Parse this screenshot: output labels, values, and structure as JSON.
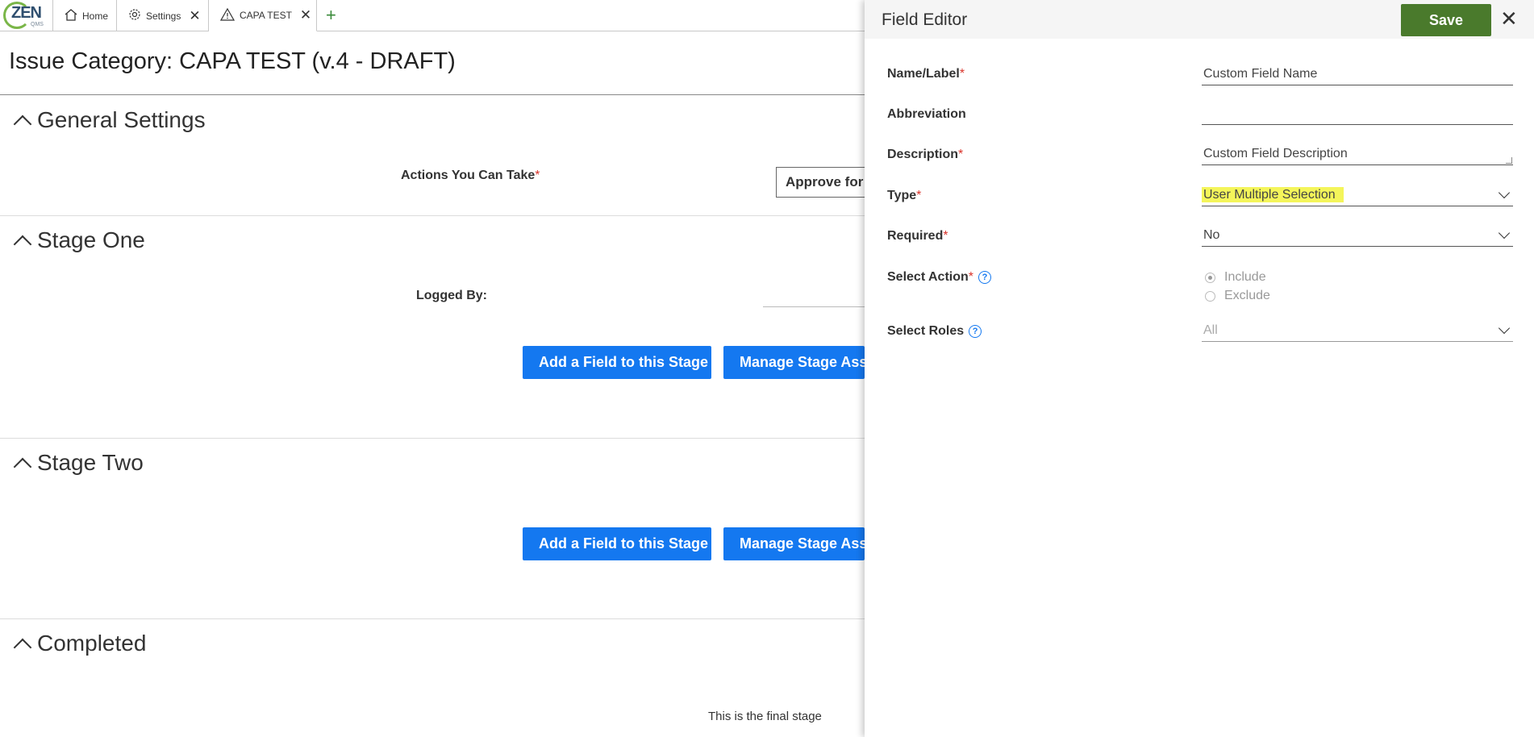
{
  "tabs": {
    "logo_text": "ZEN",
    "logo_sub": "QMS",
    "home": "Home",
    "settings": "Settings",
    "capa": "CAPA TEST",
    "add": "+"
  },
  "page": {
    "title": "Issue Category: CAPA TEST (v.4 - DRAFT)"
  },
  "sections": {
    "general": {
      "heading": "General Settings",
      "actions_label": "Actions You Can Take",
      "actions_value": "Approve for"
    },
    "stage_one": {
      "heading": "Stage One",
      "logged_by_label": "Logged By:",
      "add_field_button": "Add a Field to this Stage",
      "manage_button": "Manage Stage Assig"
    },
    "stage_two": {
      "heading": "Stage Two",
      "add_field_button": "Add a Field to this Stage",
      "manage_button": "Manage Stage Assig"
    },
    "completed": {
      "heading": "Completed",
      "note": "This is the final stage"
    }
  },
  "field_editor": {
    "title": "Field Editor",
    "save_label": "Save",
    "close_label": "✕",
    "name_label": "Name/Label",
    "name_value": "Custom Field Name",
    "abbreviation_label": "Abbreviation",
    "abbreviation_value": "",
    "description_label": "Description",
    "description_value": "Custom Field Description",
    "type_label": "Type",
    "type_value": "User Multiple Selection",
    "required_label": "Required",
    "required_value": "No",
    "select_action_label": "Select Action",
    "select_action_options": [
      "Include",
      "Exclude"
    ],
    "select_action_selected": "Include",
    "select_roles_label": "Select Roles",
    "select_roles_value": "All",
    "required_marker": "*",
    "help_glyph": "?"
  },
  "colors": {
    "primary_button": "#1478f0",
    "save_button": "#4a7a2c",
    "highlight": "#f4f55a",
    "required": "#d9342b"
  },
  "icons": [
    "home-icon",
    "gear-icon",
    "warning-icon",
    "close-icon",
    "plus-icon",
    "chevron-up-icon",
    "chevron-down-icon",
    "help-icon"
  ]
}
